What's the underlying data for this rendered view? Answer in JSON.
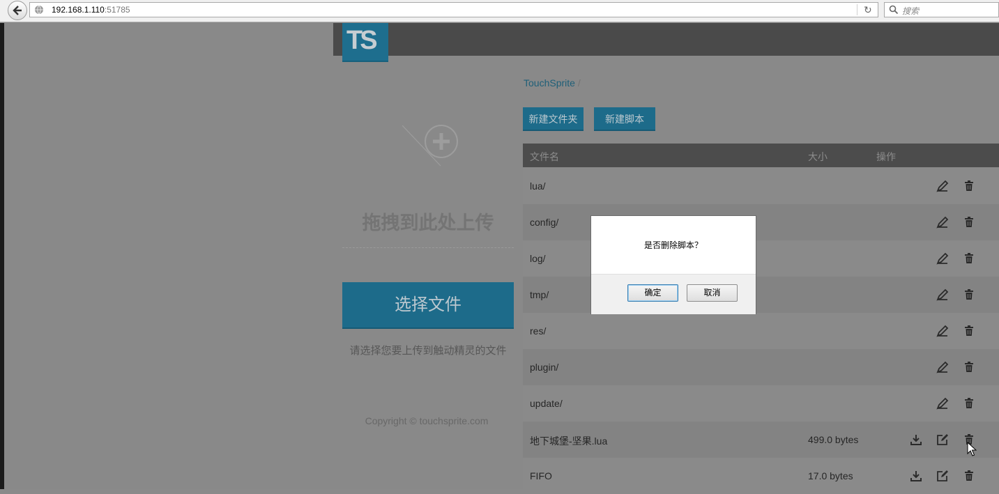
{
  "browser": {
    "url_host": "192.168.1.110",
    "url_port": ":51785",
    "search_placeholder": "搜索"
  },
  "logo": {
    "text": "TS"
  },
  "upload": {
    "drop_text": "拖拽到此处上传",
    "select_button": "选择文件",
    "hint": "请选择您要上传到触动精灵的文件",
    "copyright": "Copyright © touchsprite.com"
  },
  "breadcrumb": {
    "root": "TouchSprite",
    "sep": "/"
  },
  "actions": {
    "new_folder": "新建文件夹",
    "new_script": "新建脚本"
  },
  "table": {
    "headers": {
      "name": "文件名",
      "size": "大小",
      "ops": "操作"
    },
    "rows": [
      {
        "name": "lua/",
        "size": ""
      },
      {
        "name": "config/",
        "size": ""
      },
      {
        "name": "log/",
        "size": ""
      },
      {
        "name": "tmp/",
        "size": ""
      },
      {
        "name": "res/",
        "size": ""
      },
      {
        "name": "plugin/",
        "size": ""
      },
      {
        "name": "update/",
        "size": ""
      },
      {
        "name": "地下城堡-坚果.lua",
        "size": "499.0 bytes"
      },
      {
        "name": "FIFO",
        "size": "17.0 bytes"
      }
    ]
  },
  "dialog": {
    "message": "是否删除脚本？",
    "ok": "确定",
    "cancel": "取消"
  }
}
